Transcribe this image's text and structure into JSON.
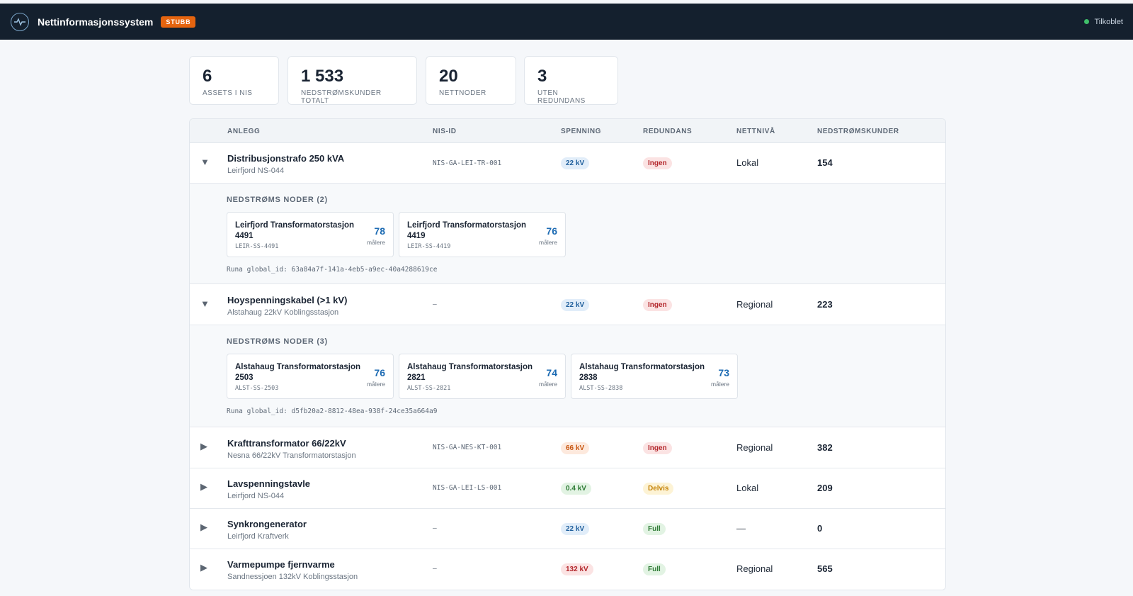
{
  "header": {
    "title": "Nettinformasjonssystem",
    "badge": "STUBB",
    "status": "Tilkoblet",
    "logo_icon": "pulse-icon"
  },
  "stats": [
    {
      "value": "6",
      "label": "ASSETS I NIS"
    },
    {
      "value": "1 533",
      "label": "NEDSTRØMSKUNDER TOTALT"
    },
    {
      "value": "20",
      "label": "NETTNODER"
    },
    {
      "value": "3",
      "label": "UTEN REDUNDANS"
    }
  ],
  "table": {
    "columns": [
      "ANLEGG",
      "NIS-ID",
      "SPENNING",
      "REDUNDANS",
      "NETTNIVÅ",
      "NEDSTRØMSKUNDER"
    ],
    "rows": [
      {
        "name": "Distribusjonstrafo 250 kVA",
        "location": "Leirfjord NS-044",
        "nis_id": "NIS-GA-LEI-TR-001",
        "voltage": "22 kV",
        "redundancy": "Ingen",
        "level": "Lokal",
        "customers": "154",
        "expanded": true
      },
      {
        "name": "Hoyspenningskabel (>1 kV)",
        "location": "Alstahaug 22kV Koblingsstasjon",
        "nis_id": "–",
        "voltage": "22 kV",
        "redundancy": "Ingen",
        "level": "Regional",
        "customers": "223",
        "expanded": true
      },
      {
        "name": "Krafttransformator 66/22kV",
        "location": "Nesna 66/22kV Transformatorstasjon",
        "nis_id": "NIS-GA-NES-KT-001",
        "voltage": "66 kV",
        "redundancy": "Ingen",
        "level": "Regional",
        "customers": "382",
        "expanded": false
      },
      {
        "name": "Lavspenningstavle",
        "location": "Leirfjord NS-044",
        "nis_id": "NIS-GA-LEI-LS-001",
        "voltage": "0.4 kV",
        "redundancy": "Delvis",
        "level": "Lokal",
        "customers": "209",
        "expanded": false
      },
      {
        "name": "Synkrongenerator",
        "location": "Leirfjord Kraftverk",
        "nis_id": "–",
        "voltage": "22 kV",
        "redundancy": "Full",
        "level": "—",
        "customers": "0",
        "expanded": false
      },
      {
        "name": "Varmepumpe fjernvarme",
        "location": "Sandnessjoen 132kV Koblingsstasjon",
        "nis_id": "–",
        "voltage": "132 kV",
        "redundancy": "Full",
        "level": "Regional",
        "customers": "565",
        "expanded": false
      }
    ],
    "expansions": [
      {
        "title": "NEDSTRØMS NODER (2)",
        "nodes": [
          {
            "name": "Leirfjord Transformatorstasjon 4491",
            "id": "LEIR-SS-4491",
            "count": "78",
            "unit": "målere"
          },
          {
            "name": "Leirfjord Transformatorstasjon 4419",
            "id": "LEIR-SS-4419",
            "count": "76",
            "unit": "målere"
          }
        ],
        "runa": "Runa global_id: 63a84a7f-141a-4eb5-a9ec-40a4288619ce"
      },
      {
        "title": "NEDSTRØMS NODER (3)",
        "nodes": [
          {
            "name": "Alstahaug Transformatorstasjon 2503",
            "id": "ALST-SS-2503",
            "count": "76",
            "unit": "målere"
          },
          {
            "name": "Alstahaug Transformatorstasjon 2821",
            "id": "ALST-SS-2821",
            "count": "74",
            "unit": "målere"
          },
          {
            "name": "Alstahaug Transformatorstasjon 2838",
            "id": "ALST-SS-2838",
            "count": "73",
            "unit": "målere"
          }
        ],
        "runa": "Runa global_id: d5fb20a2-8812-48ea-938f-24ce35a664a9"
      }
    ],
    "expanded_icon": "chevron-down-icon",
    "collapsed_icon": "chevron-right-icon"
  },
  "colors": {
    "topbar": "#14202e",
    "badge": "#e5640f",
    "online": "#3fbf6a",
    "count_blue": "#1d6bb3"
  }
}
